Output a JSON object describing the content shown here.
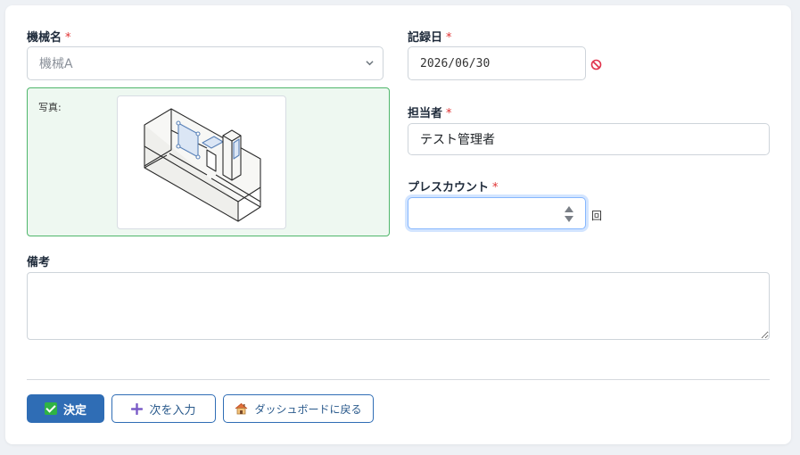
{
  "form": {
    "machine": {
      "label": "機械名",
      "required_mark": "*",
      "selected": "機械A"
    },
    "photo": {
      "label": "写真:"
    },
    "record_date": {
      "label": "記録日",
      "required_mark": "*",
      "value": "2026/06/30",
      "clear_icon": "no-entry-icon"
    },
    "person": {
      "label": "担当者",
      "required_mark": "*",
      "value": "テスト管理者"
    },
    "press_count": {
      "label": "プレスカウント",
      "required_mark": "*",
      "value": "",
      "unit": "回"
    },
    "memo": {
      "label": "備考",
      "value": ""
    }
  },
  "actions": {
    "submit_label": "決定",
    "next_label": "次を入力",
    "dashboard_label": "ダッシュボードに戻る"
  },
  "colors": {
    "primary": "#2f6db5",
    "required": "#e03131",
    "photo_bg": "#eef8f1",
    "photo_border": "#4fb66b",
    "focus": "#86b7fe"
  }
}
